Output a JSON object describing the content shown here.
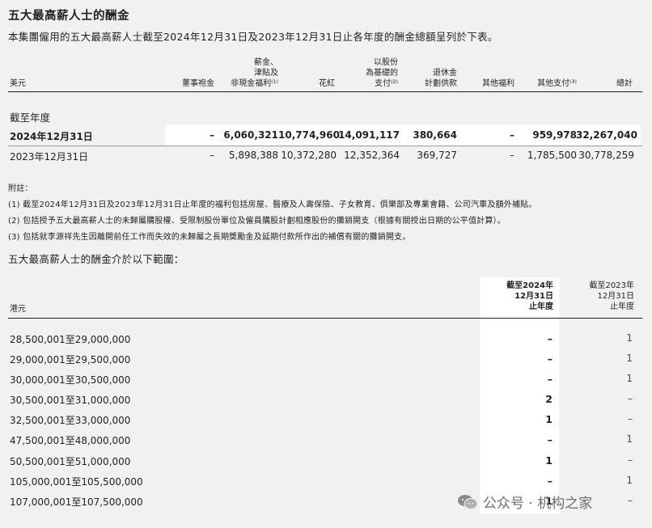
{
  "title": "五大最高薪人士的酬金",
  "intro": "本集團僱用的五大最高薪人士截至2024年12月31日及2023年12月31日止各年度的酬金總額呈列於下表。",
  "table1": {
    "currency": "美元",
    "headers": [
      [
        "董事袍金"
      ],
      [
        "薪金、",
        "津貼及",
        "非現金福利⁽¹⁾"
      ],
      [
        "花紅"
      ],
      [
        "以股份",
        "為基礎的",
        "支付⁽²⁾"
      ],
      [
        "退休金",
        "計劃供款"
      ],
      [
        "其他福利"
      ],
      [
        "其他支付⁽³⁾"
      ],
      [
        "總計"
      ]
    ],
    "section_label": "截至年度",
    "rows": [
      {
        "label": "2024年12月31日",
        "cells": [
          "–",
          "6,060,321",
          "10,774,960",
          "14,091,117",
          "380,664",
          "–",
          "959,978",
          "32,267,040"
        ]
      },
      {
        "label": "2023年12月31日",
        "cells": [
          "–",
          "5,898,388",
          "10,372,280",
          "12,352,364",
          "369,727",
          "–",
          "1,785,500",
          "30,778,259"
        ]
      }
    ]
  },
  "notes": {
    "heading": "附註：",
    "items": [
      "(1)  截至2024年12月31日及2023年12月31日止年度的福利包括房屋、醫療及人壽保險、子女教育、俱樂部及專業會籍、公司汽車及額外補貼。",
      "(2)  包括授予五大最高薪人士的未歸屬購股權、受限制股份單位及僱員購股計劃相應股份的攤銷開支（根據有關授出日期的公平值計算）。",
      "(3)  包括就李源祥先生因離開前任工作而失效的未歸屬之長期獎勵金及延期付款所作出的補償有關的攤銷開支。"
    ]
  },
  "table2": {
    "title": "五大最高薪人士的酬金介於以下範圍：",
    "currency": "港元",
    "col2024": [
      "截至2024年",
      "12月31日",
      "止年度"
    ],
    "col2023": [
      "截至2023年",
      "12月31日",
      "止年度"
    ],
    "rows": [
      {
        "range": "28,500,001至29,000,000",
        "y2024": "–",
        "y2023": "1"
      },
      {
        "range": "29,000,001至29,500,000",
        "y2024": "–",
        "y2023": "1"
      },
      {
        "range": "30,000,001至30,500,000",
        "y2024": "–",
        "y2023": "1"
      },
      {
        "range": "30,500,001至31,000,000",
        "y2024": "2",
        "y2023": "–"
      },
      {
        "range": "32,500,001至33,000,000",
        "y2024": "1",
        "y2023": "–"
      },
      {
        "range": "47,500,001至48,000,000",
        "y2024": "–",
        "y2023": "1"
      },
      {
        "range": "50,500,001至51,000,000",
        "y2024": "1",
        "y2023": "–"
      },
      {
        "range": "105,000,001至105,500,000",
        "y2024": "–",
        "y2023": "1"
      },
      {
        "range": "107,000,001至107,500,000",
        "y2024": "1",
        "y2023": "–"
      }
    ]
  },
  "watermark": {
    "text": "公众号 · 机构之家",
    "icon": "wechat-icon"
  }
}
